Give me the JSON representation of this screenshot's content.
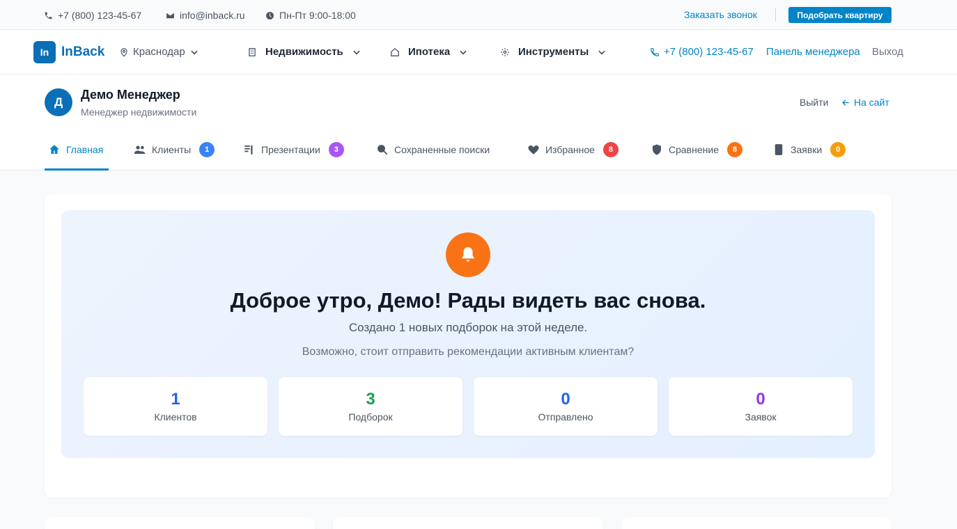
{
  "topbar": {
    "phone": "+7 (800) 123-45-67",
    "email": "info@inback.ru",
    "hours": "Пн-Пт 9:00-18:00",
    "callback": "Заказать звонок",
    "pick_button": "Подобрать квартиру"
  },
  "header": {
    "logo_mark": "In",
    "logo_text": "InBack",
    "city": "Краснодар",
    "nav": {
      "realty": "Недвижимость",
      "mortgage": "Ипотека",
      "tools": "Инструменты"
    },
    "phone": "+7 (800) 123-45-67",
    "manager_panel": "Панель менеджера",
    "exit": "Выход"
  },
  "profile": {
    "avatar_letter": "Д",
    "name": "Демо Менеджер",
    "role": "Менеджер недвижимости",
    "logout": "Выйти",
    "to_site": "На сайт"
  },
  "tabs": [
    {
      "label": "Главная",
      "icon": "home-icon",
      "active": true
    },
    {
      "label": "Клиенты",
      "icon": "users-icon",
      "badge": "1",
      "badge_color": "#3b82f6"
    },
    {
      "label": "Презентации",
      "icon": "presentation-icon",
      "badge": "3",
      "badge_color": "#a855f7"
    },
    {
      "label": "Сохраненные поиски",
      "icon": "search-icon"
    },
    {
      "label": "Избранное",
      "icon": "heart-icon",
      "badge": "8",
      "badge_color": "#ef4444"
    },
    {
      "label": "Сравнение",
      "icon": "shield-icon",
      "badge": "8",
      "badge_color": "#f97316"
    },
    {
      "label": "Заявки",
      "icon": "phone-device-icon",
      "badge": "0",
      "badge_color": "#f59e0b"
    }
  ],
  "welcome": {
    "greeting": "Доброе утро, Демо! Рады видеть вас снова.",
    "line1": "Создано 1 новых подборок на этой неделе.",
    "line2": "Возможно, стоит отправить рекомендации активным клиентам?",
    "stats": [
      {
        "value": "1",
        "label": "Клиентов",
        "color": "#2563eb"
      },
      {
        "value": "3",
        "label": "Подборок",
        "color": "#16a34a"
      },
      {
        "value": "0",
        "label": "Отправлено",
        "color": "#2563eb"
      },
      {
        "value": "0",
        "label": "Заявок",
        "color": "#9333ea"
      }
    ]
  },
  "colors": {
    "accent": "#0284c7",
    "brand": "#0b6fb8",
    "bell": "#f97316"
  }
}
